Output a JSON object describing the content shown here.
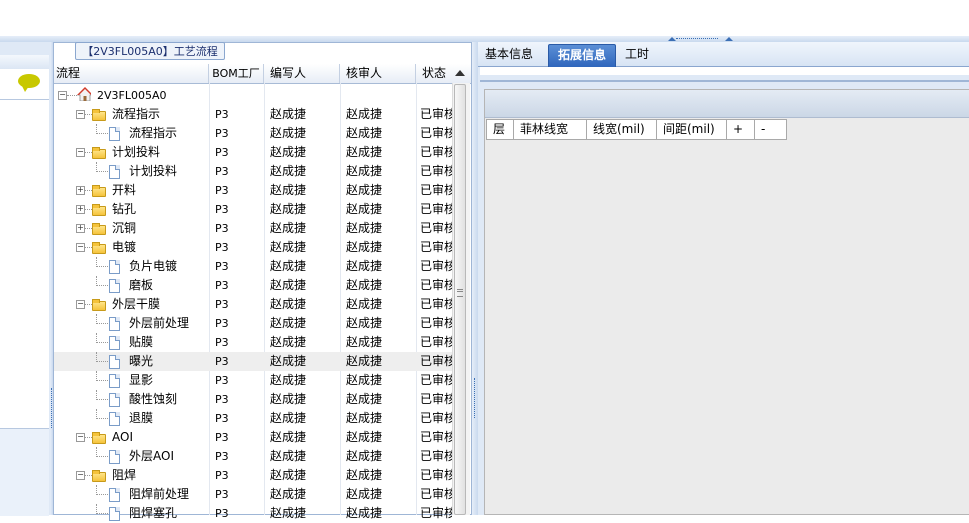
{
  "tree_panel": {
    "title": "【2V3FL005A0】工艺流程",
    "columns": [
      "流程",
      "BOM工厂",
      "编写人",
      "核审人",
      "状态"
    ],
    "rows": [
      {
        "label": "2V3FL005A0",
        "type": "root",
        "level": 0,
        "expander": "minus",
        "bom": "",
        "writer": "",
        "reviewer": "",
        "status": ""
      },
      {
        "label": "流程指示",
        "type": "folder",
        "level": 1,
        "expander": "minus",
        "bom": "P3",
        "writer": "赵成捷",
        "reviewer": "赵成捷",
        "status": "已审核"
      },
      {
        "label": "流程指示",
        "type": "doc",
        "level": 2,
        "expander": "",
        "bom": "P3",
        "writer": "赵成捷",
        "reviewer": "赵成捷",
        "status": "已审核"
      },
      {
        "label": "计划投料",
        "type": "folder",
        "level": 1,
        "expander": "minus",
        "bom": "P3",
        "writer": "赵成捷",
        "reviewer": "赵成捷",
        "status": "已审核"
      },
      {
        "label": "计划投料",
        "type": "doc",
        "level": 2,
        "expander": "",
        "bom": "P3",
        "writer": "赵成捷",
        "reviewer": "赵成捷",
        "status": "已审核"
      },
      {
        "label": "开料",
        "type": "folder",
        "level": 1,
        "expander": "plus",
        "bom": "P3",
        "writer": "赵成捷",
        "reviewer": "赵成捷",
        "status": "已审核"
      },
      {
        "label": "钻孔",
        "type": "folder",
        "level": 1,
        "expander": "plus",
        "bom": "P3",
        "writer": "赵成捷",
        "reviewer": "赵成捷",
        "status": "已审核"
      },
      {
        "label": "沉铜",
        "type": "folder",
        "level": 1,
        "expander": "plus",
        "bom": "P3",
        "writer": "赵成捷",
        "reviewer": "赵成捷",
        "status": "已审核"
      },
      {
        "label": "电镀",
        "type": "folder",
        "level": 1,
        "expander": "minus",
        "bom": "P3",
        "writer": "赵成捷",
        "reviewer": "赵成捷",
        "status": "已审核"
      },
      {
        "label": "负片电镀",
        "type": "doc",
        "level": 2,
        "expander": "",
        "bom": "P3",
        "writer": "赵成捷",
        "reviewer": "赵成捷",
        "status": "已审核"
      },
      {
        "label": "磨板",
        "type": "doc",
        "level": 2,
        "expander": "",
        "bom": "P3",
        "writer": "赵成捷",
        "reviewer": "赵成捷",
        "status": "已审核"
      },
      {
        "label": "外层干膜",
        "type": "folder",
        "level": 1,
        "expander": "minus",
        "bom": "P3",
        "writer": "赵成捷",
        "reviewer": "赵成捷",
        "status": "已审核"
      },
      {
        "label": "外层前处理",
        "type": "doc",
        "level": 2,
        "expander": "",
        "bom": "P3",
        "writer": "赵成捷",
        "reviewer": "赵成捷",
        "status": "已审核"
      },
      {
        "label": "贴膜",
        "type": "doc",
        "level": 2,
        "expander": "",
        "bom": "P3",
        "writer": "赵成捷",
        "reviewer": "赵成捷",
        "status": "已审核"
      },
      {
        "label": "曝光",
        "type": "doc",
        "level": 2,
        "expander": "",
        "bom": "P3",
        "writer": "赵成捷",
        "reviewer": "赵成捷",
        "status": "已审核",
        "selected": true
      },
      {
        "label": "显影",
        "type": "doc",
        "level": 2,
        "expander": "",
        "bom": "P3",
        "writer": "赵成捷",
        "reviewer": "赵成捷",
        "status": "已审核"
      },
      {
        "label": "酸性蚀刻",
        "type": "doc",
        "level": 2,
        "expander": "",
        "bom": "P3",
        "writer": "赵成捷",
        "reviewer": "赵成捷",
        "status": "已审核"
      },
      {
        "label": "退膜",
        "type": "doc",
        "level": 2,
        "expander": "",
        "bom": "P3",
        "writer": "赵成捷",
        "reviewer": "赵成捷",
        "status": "已审核"
      },
      {
        "label": "AOI",
        "type": "folder",
        "level": 1,
        "expander": "minus",
        "bom": "P3",
        "writer": "赵成捷",
        "reviewer": "赵成捷",
        "status": "已审核"
      },
      {
        "label": "外层AOI",
        "type": "doc",
        "level": 2,
        "expander": "",
        "bom": "P3",
        "writer": "赵成捷",
        "reviewer": "赵成捷",
        "status": "已审核"
      },
      {
        "label": "阻焊",
        "type": "folder",
        "level": 1,
        "expander": "minus",
        "bom": "P3",
        "writer": "赵成捷",
        "reviewer": "赵成捷",
        "status": "已审核"
      },
      {
        "label": "阻焊前处理",
        "type": "doc",
        "level": 2,
        "expander": "",
        "bom": "P3",
        "writer": "赵成捷",
        "reviewer": "赵成捷",
        "status": "已审核"
      },
      {
        "label": "阻焊塞孔",
        "type": "doc",
        "level": 2,
        "expander": "",
        "bom": "P3",
        "writer": "赵成捷",
        "reviewer": "赵成捷",
        "status": "已审核"
      }
    ]
  },
  "right_panel": {
    "tabs": [
      {
        "label": "基本信息",
        "active": false
      },
      {
        "label": "拓展信息",
        "active": true
      },
      {
        "label": "工时",
        "active": false
      }
    ],
    "grid_columns": [
      "层",
      "菲林线宽",
      "线宽(mil)",
      "间距(mil)",
      "+",
      "-"
    ]
  },
  "left_panel": {
    "icon": "comment-bubble-icon"
  },
  "colors": {
    "accent": "#2f66bc",
    "panel_bg": "#dfe9f6",
    "folder": "#f5c33b",
    "home_roof": "#d23a2a"
  }
}
